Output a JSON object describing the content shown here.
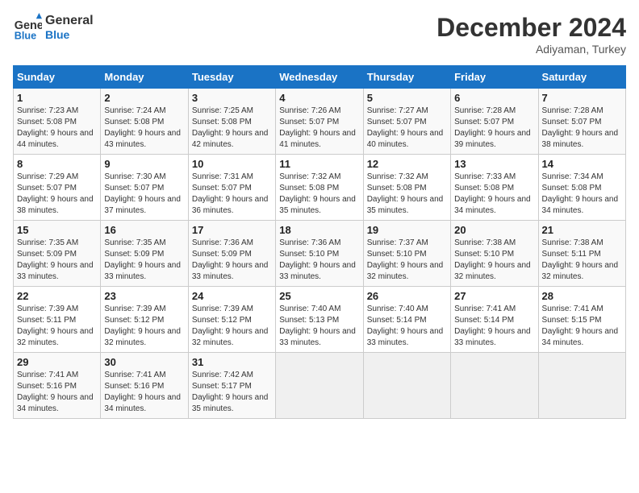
{
  "header": {
    "logo_line1": "General",
    "logo_line2": "Blue",
    "month": "December 2024",
    "location": "Adiyaman, Turkey"
  },
  "weekdays": [
    "Sunday",
    "Monday",
    "Tuesday",
    "Wednesday",
    "Thursday",
    "Friday",
    "Saturday"
  ],
  "weeks": [
    [
      {
        "day": "1",
        "info": "Sunrise: 7:23 AM\nSunset: 5:08 PM\nDaylight: 9 hours and 44 minutes."
      },
      {
        "day": "2",
        "info": "Sunrise: 7:24 AM\nSunset: 5:08 PM\nDaylight: 9 hours and 43 minutes."
      },
      {
        "day": "3",
        "info": "Sunrise: 7:25 AM\nSunset: 5:08 PM\nDaylight: 9 hours and 42 minutes."
      },
      {
        "day": "4",
        "info": "Sunrise: 7:26 AM\nSunset: 5:07 PM\nDaylight: 9 hours and 41 minutes."
      },
      {
        "day": "5",
        "info": "Sunrise: 7:27 AM\nSunset: 5:07 PM\nDaylight: 9 hours and 40 minutes."
      },
      {
        "day": "6",
        "info": "Sunrise: 7:28 AM\nSunset: 5:07 PM\nDaylight: 9 hours and 39 minutes."
      },
      {
        "day": "7",
        "info": "Sunrise: 7:28 AM\nSunset: 5:07 PM\nDaylight: 9 hours and 38 minutes."
      }
    ],
    [
      {
        "day": "8",
        "info": "Sunrise: 7:29 AM\nSunset: 5:07 PM\nDaylight: 9 hours and 38 minutes."
      },
      {
        "day": "9",
        "info": "Sunrise: 7:30 AM\nSunset: 5:07 PM\nDaylight: 9 hours and 37 minutes."
      },
      {
        "day": "10",
        "info": "Sunrise: 7:31 AM\nSunset: 5:07 PM\nDaylight: 9 hours and 36 minutes."
      },
      {
        "day": "11",
        "info": "Sunrise: 7:32 AM\nSunset: 5:08 PM\nDaylight: 9 hours and 35 minutes."
      },
      {
        "day": "12",
        "info": "Sunrise: 7:32 AM\nSunset: 5:08 PM\nDaylight: 9 hours and 35 minutes."
      },
      {
        "day": "13",
        "info": "Sunrise: 7:33 AM\nSunset: 5:08 PM\nDaylight: 9 hours and 34 minutes."
      },
      {
        "day": "14",
        "info": "Sunrise: 7:34 AM\nSunset: 5:08 PM\nDaylight: 9 hours and 34 minutes."
      }
    ],
    [
      {
        "day": "15",
        "info": "Sunrise: 7:35 AM\nSunset: 5:09 PM\nDaylight: 9 hours and 33 minutes."
      },
      {
        "day": "16",
        "info": "Sunrise: 7:35 AM\nSunset: 5:09 PM\nDaylight: 9 hours and 33 minutes."
      },
      {
        "day": "17",
        "info": "Sunrise: 7:36 AM\nSunset: 5:09 PM\nDaylight: 9 hours and 33 minutes."
      },
      {
        "day": "18",
        "info": "Sunrise: 7:36 AM\nSunset: 5:10 PM\nDaylight: 9 hours and 33 minutes."
      },
      {
        "day": "19",
        "info": "Sunrise: 7:37 AM\nSunset: 5:10 PM\nDaylight: 9 hours and 32 minutes."
      },
      {
        "day": "20",
        "info": "Sunrise: 7:38 AM\nSunset: 5:10 PM\nDaylight: 9 hours and 32 minutes."
      },
      {
        "day": "21",
        "info": "Sunrise: 7:38 AM\nSunset: 5:11 PM\nDaylight: 9 hours and 32 minutes."
      }
    ],
    [
      {
        "day": "22",
        "info": "Sunrise: 7:39 AM\nSunset: 5:11 PM\nDaylight: 9 hours and 32 minutes."
      },
      {
        "day": "23",
        "info": "Sunrise: 7:39 AM\nSunset: 5:12 PM\nDaylight: 9 hours and 32 minutes."
      },
      {
        "day": "24",
        "info": "Sunrise: 7:39 AM\nSunset: 5:12 PM\nDaylight: 9 hours and 32 minutes."
      },
      {
        "day": "25",
        "info": "Sunrise: 7:40 AM\nSunset: 5:13 PM\nDaylight: 9 hours and 33 minutes."
      },
      {
        "day": "26",
        "info": "Sunrise: 7:40 AM\nSunset: 5:14 PM\nDaylight: 9 hours and 33 minutes."
      },
      {
        "day": "27",
        "info": "Sunrise: 7:41 AM\nSunset: 5:14 PM\nDaylight: 9 hours and 33 minutes."
      },
      {
        "day": "28",
        "info": "Sunrise: 7:41 AM\nSunset: 5:15 PM\nDaylight: 9 hours and 34 minutes."
      }
    ],
    [
      {
        "day": "29",
        "info": "Sunrise: 7:41 AM\nSunset: 5:16 PM\nDaylight: 9 hours and 34 minutes."
      },
      {
        "day": "30",
        "info": "Sunrise: 7:41 AM\nSunset: 5:16 PM\nDaylight: 9 hours and 34 minutes."
      },
      {
        "day": "31",
        "info": "Sunrise: 7:42 AM\nSunset: 5:17 PM\nDaylight: 9 hours and 35 minutes."
      },
      null,
      null,
      null,
      null
    ]
  ]
}
